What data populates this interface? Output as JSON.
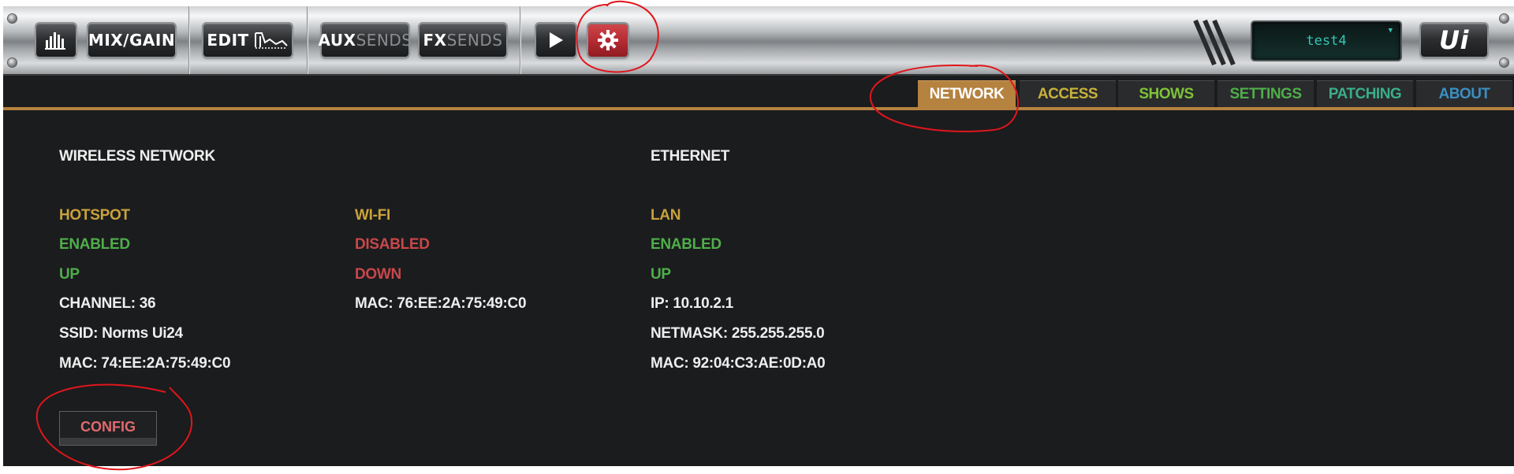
{
  "toolbar": {
    "meters_icon": "bar-meters-icon",
    "mix_gain_label": "MIX/GAIN",
    "edit_label": "EDIT",
    "aux_label_main": "AUX",
    "aux_label_sub": "SENDS",
    "fx_label_main": "FX",
    "fx_label_sub": "SENDS",
    "play_icon": "play-icon",
    "settings_icon": "gear-icon",
    "show_display": "test4",
    "logo": "Ui"
  },
  "tabs": [
    {
      "label": "NETWORK",
      "active": true,
      "color": "#ffffff"
    },
    {
      "label": "ACCESS",
      "active": false,
      "color": "#c9b23a"
    },
    {
      "label": "SHOWS",
      "active": false,
      "color": "#7ec23a"
    },
    {
      "label": "SETTINGS",
      "active": false,
      "color": "#4fae4a"
    },
    {
      "label": "PATCHING",
      "active": false,
      "color": "#3aae88"
    },
    {
      "label": "ABOUT",
      "active": false,
      "color": "#3a8fc2"
    }
  ],
  "wireless": {
    "heading": "WIRELESS NETWORK",
    "hotspot": {
      "title": "HOTSPOT",
      "state": "ENABLED",
      "link": "UP",
      "channel": "CHANNEL: 36",
      "ssid": "SSID: Norms Ui24",
      "mac": "MAC: 74:EE:2A:75:49:C0"
    },
    "wifi": {
      "title": "WI-FI",
      "state": "DISABLED",
      "link": "DOWN",
      "mac": "MAC: 76:EE:2A:75:49:C0"
    },
    "config_label": "CONFIG"
  },
  "ethernet": {
    "heading": "ETHERNET",
    "title": "LAN",
    "state": "ENABLED",
    "link": "UP",
    "ip": "IP: 10.10.2.1",
    "netmask": "NETMASK: 255.255.255.0",
    "mac": "MAC: 92:04:C3:AE:0D:A0"
  },
  "colors": {
    "accent": "#b5823f",
    "enabled": "#4fae4a",
    "disabled": "#c9474a",
    "section_title": "#c9a23a",
    "annotation": "#e0161c"
  }
}
